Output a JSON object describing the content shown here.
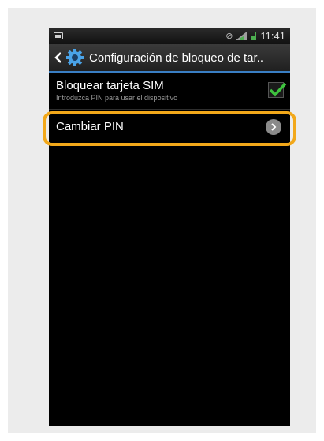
{
  "status_bar": {
    "time": "11:41",
    "icons": [
      "image-icon",
      "no-sim-icon",
      "signal-icon",
      "battery-icon"
    ]
  },
  "title_bar": {
    "title": "Configuración de bloqueo de tar..",
    "icons": [
      "back-icon",
      "gear-icon"
    ]
  },
  "settings": {
    "sim_lock": {
      "title": "Bloquear tarjeta SIM",
      "subtitle": "Introduzca PIN para usar el dispositivo",
      "checked": true
    },
    "change_pin": {
      "title": "Cambiar PIN"
    }
  },
  "colors": {
    "accent": "#3a7fc4",
    "highlight": "#f2a81a",
    "check": "#3ec23e"
  }
}
